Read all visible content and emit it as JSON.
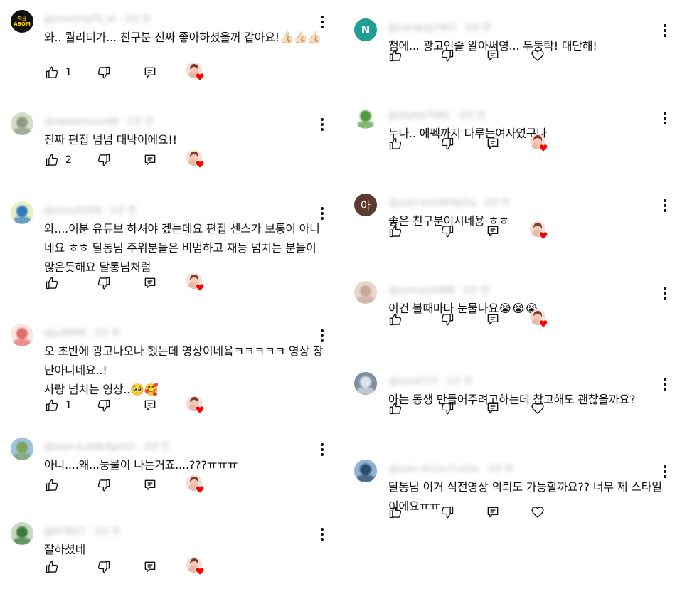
{
  "left": [
    {
      "author": "@monthlyFS_kt · 2년 전",
      "avatar": {
        "kind": "text",
        "text": "지금 ABOM",
        "bg": "#111111"
      },
      "text": "와.. 퀄리티가... 친구분 진짜 좋아하셨을꺼 같아요!👍🏻👍🏻👍🏻",
      "likes": "1",
      "action": "creator-heart"
    },
    {
      "author": "@sweetmoon68 · 2년 전",
      "avatar": {
        "kind": "photo",
        "bg": "#d9ddc8",
        "fg": "#8c9a84"
      },
      "text": "진짜 편집 넘넘 대박이에요!!",
      "likes": "2",
      "action": "creator-heart"
    },
    {
      "author": "@seoul0209 · 2년 전",
      "avatar": {
        "kind": "photo",
        "bg": "#e8f0c2",
        "fg": "#2f7bbf"
      },
      "text": "와....이분 유튜브 하셔야 겠는데요 편집 센스가 보통이 아니네요 ㅎㅎ 달통님 주위분들은 비범하고 재능 넘치는 분들이 많은듯해요 달통님처럼",
      "likes": "",
      "action": "creator-heart"
    },
    {
      "author": "@ju9898 · 2년 전",
      "avatar": {
        "kind": "photo",
        "bg": "#f7e6e3",
        "fg": "#e36c6c"
      },
      "text": "오 초반에 광고나오나 했는데 영상이네욬ㅋㅋㅋㅋㅋ 영상 장난아니네요..!\n사랑 넘치는 영상..🥺🥰",
      "likes": "1",
      "action": "creator-heart"
    },
    {
      "author": "@user-zu4ab3gm1t · 2년 전",
      "avatar": {
        "kind": "photo",
        "bg": "#9ec3dd",
        "fg": "#7fa25a"
      },
      "text": "아니....왜...눙물이 나는거죠....???ㅠㅠㅠ",
      "likes": "",
      "action": "creator-heart"
    },
    {
      "author": "@KYW27 · 2년 전",
      "avatar": {
        "kind": "photo",
        "bg": "#c9d9c2",
        "fg": "#3b7a3a"
      },
      "text": "잘하셨네",
      "likes": "",
      "action": "creator-heart"
    }
  ],
  "right": [
    {
      "author": "@nerdpig7467 · 2년 전",
      "avatar": {
        "kind": "letter",
        "text": "N",
        "bg": "#1f9e94"
      },
      "text": "첨에... 광고인줄 알아써영... 두둥탁! 대단해!",
      "likes": "",
      "action": "heart-outline"
    },
    {
      "author": "@skylee7681 · 2년 전",
      "avatar": {
        "kind": "photo",
        "bg": "#ffffff",
        "fg": "#4f9a3d"
      },
      "text": "누나.. 에펙까지 다루는여자였구나",
      "likes": "",
      "action": "creator-heart"
    },
    {
      "author": "@user-te4z6h9y5q · 2년 전",
      "avatar": {
        "kind": "letter",
        "text": "아",
        "bg": "#5d3a2e"
      },
      "text": "좋은 친구분이시네용 ㅎㅎ",
      "likes": "",
      "action": "creator-heart"
    },
    {
      "author": "@sunnyoh488 · 2년 전",
      "avatar": {
        "kind": "photo",
        "bg": "#e9d6d0",
        "fg": "#c9a79b"
      },
      "text": "이건 볼때마다 눈물나요😭😭😭",
      "likes": "",
      "action": "creator-heart"
    },
    {
      "author": "@seed727 · 1년 전",
      "avatar": {
        "kind": "photo",
        "bg": "#7e8fa1",
        "fg": "#dde3ea"
      },
      "text": "아는 동생 만들어주려고하는데 참고해도 괜찮을까요?",
      "likes": "",
      "action": "heart-outline"
    },
    {
      "author": "@user-xk1ou7ca1w · 1년 전",
      "avatar": {
        "kind": "photo",
        "bg": "#8fb2d6",
        "fg": "#2c4a6b"
      },
      "text": "달통님 이거 식전영상 의뢰도 가능할까요?? 너무 제 스타일이에요ㅠㅠ",
      "likes": "",
      "action": "heart-outline"
    }
  ]
}
